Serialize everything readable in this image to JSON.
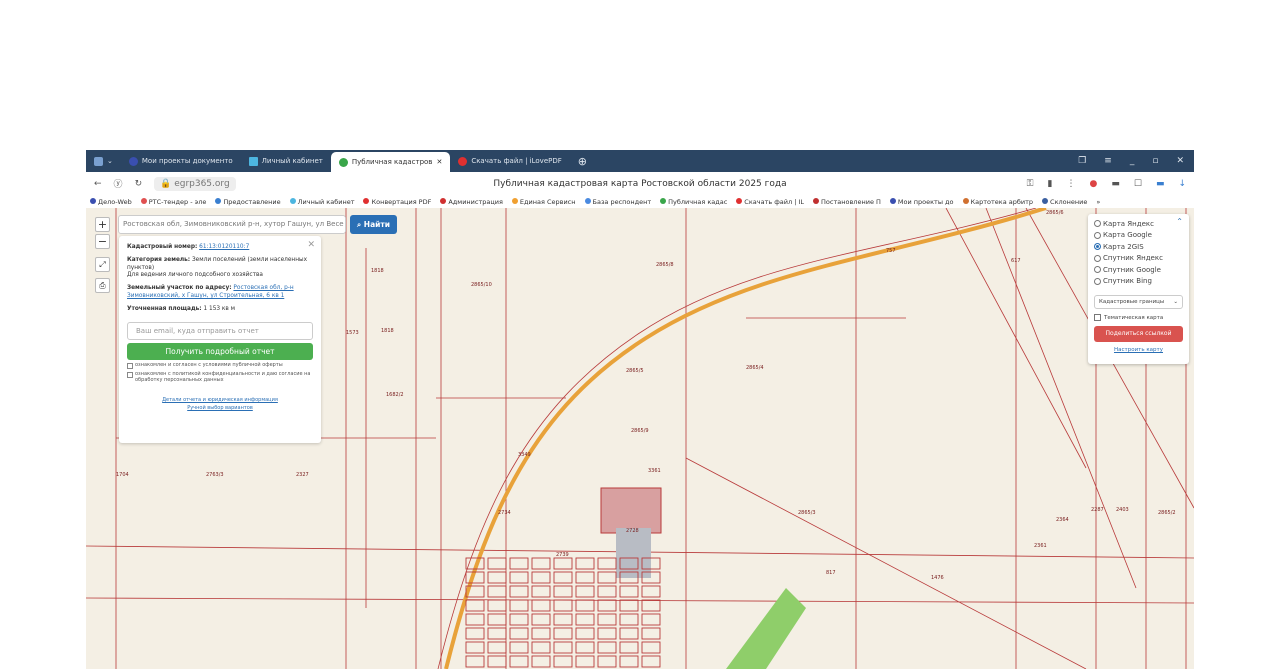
{
  "browser": {
    "tabs": [
      {
        "label": "Мои проекты документо",
        "active": false
      },
      {
        "label": "Личный кабинет",
        "active": false
      },
      {
        "label": "Публичная кадастров",
        "active": true
      },
      {
        "label": "Скачать файл | iLovePDF",
        "active": false
      }
    ],
    "url": "egrp365.org",
    "page_title": "Публичная кадастровая карта Ростовской области 2025 года",
    "bookmarks": [
      "Дело-Web",
      "РТС-тендер - эле",
      "Предоставление",
      "Личный кабинет",
      "Конвертация PDF",
      "Администрация",
      "Единая Сервисн",
      "База респондент",
      "Публичная кадас",
      "Скачать файл | IL",
      "Постановление П",
      "Мои проекты до",
      "Картотека арбитр",
      "Склонение",
      "»"
    ]
  },
  "map": {
    "search_value": "Ростовская обл, Зимовниковский р-н, хутор Гашун, ул Весе",
    "search_button": "Найти",
    "zoom_in": "+",
    "zoom_out": "−",
    "info": {
      "cad_label": "Кадастровый номер:",
      "cad_value": "61:13:0120110:7",
      "cat_label": "Категория земель:",
      "cat_value": "Земли поселений (земли населенных пунктов)",
      "use": "Для ведения личного подсобного хозяйства",
      "addr_label": "Земельный участок по адресу:",
      "addr_value": "Ростовская обл, р-н Зимовниковский, х Гашун, ул Строительная, 6 кв 1",
      "area_label": "Уточненная площадь:",
      "area_value": "1 153 кв м",
      "email_placeholder": "Ваш email, куда отправить отчет",
      "get_report": "Получить подробный отчет",
      "agree1": "ознакомлен и согласен с условиями публичной оферты",
      "agree2": "ознакомлен с политикой конфиденциальности и даю согласие на обработку персональных данных",
      "details_link": "Детали отчета и юридическая информация",
      "manual_link": "Ручной выбор вариантов"
    },
    "layers": {
      "options": [
        "Карта Яндекс",
        "Карта Google",
        "Карта 2GIS",
        "Спутник Яндекс",
        "Спутник Google",
        "Спутник Bing"
      ],
      "selected": "Карта 2GIS",
      "select_value": "Кадастровые границы",
      "thematic": "Тематическая карта",
      "share": "Поделиться ссылкой",
      "configure": "Настроить карту"
    },
    "parcel_labels": [
      "2865/6",
      "2865/8",
      "2865/10",
      "1818",
      "1573",
      "1818",
      "2865/5",
      "2865/4",
      "2865/9",
      "1682/2",
      "1704",
      "2763/3",
      "2327",
      "2865/3",
      "1476",
      "2361",
      "2364",
      "2287",
      "2403",
      "757",
      "817",
      "3349",
      "3361",
      "2739",
      "2728",
      "2734",
      "617",
      "2865/2"
    ]
  },
  "colors": {
    "tabbar": "#2b4563",
    "map_bg": "#f4efe4",
    "parcel_line": "#b83a3a",
    "road": "#e8a23a",
    "find": "#2a6fb5",
    "report": "#4caf50",
    "share": "#d9534f"
  }
}
